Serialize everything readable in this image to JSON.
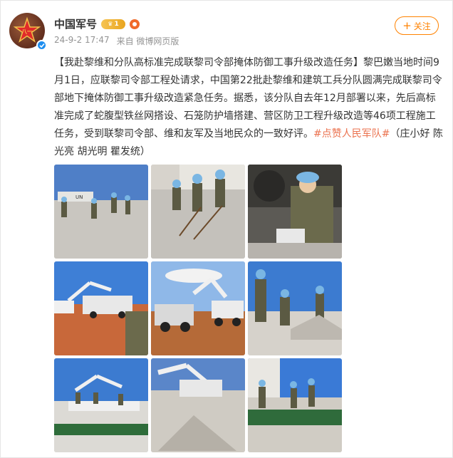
{
  "post": {
    "author": "中国军号",
    "vip_level": "1",
    "timestamp": "24-9-2 17:47",
    "source": "来自 微博网页版",
    "follow_label": "关注",
    "text_main": "【我赴黎维和分队高标准完成联黎司令部掩体防御工事升级改造任务】黎巴嫩当地时间9月1日，应联黎司令部工程处请求，中国第22批赴黎维和建筑工兵分队圆满完成联黎司令部地下掩体防御工事升级改造紧急任务。据悉，该分队自去年12月部署以来，先后高标准完成了蛇腹型铁丝网搭设、石笼防护墙搭建、营区防卫工程升级改造等46项工程施工任务，受到联黎司令部、维和友军及当地民众的一致好评。",
    "hashtag": "#点赞人民军队#",
    "credits": "（庄小好 陈光亮 胡光明 瞿发统）"
  },
  "colors": {
    "accent_orange": "#ff8200",
    "tag_color": "#eb7350",
    "meta_gray": "#939393"
  },
  "images": [
    {
      "name": "photo-1",
      "scene": "soldiers shoveling gravel"
    },
    {
      "name": "photo-2",
      "scene": "soldiers shoveling gravel"
    },
    {
      "name": "photo-3",
      "scene": "soldier pouring cement bag"
    },
    {
      "name": "photo-4",
      "scene": "excavator and truck"
    },
    {
      "name": "photo-5",
      "scene": "excavator loading truck"
    },
    {
      "name": "photo-6",
      "scene": "soldiers shoveling"
    },
    {
      "name": "photo-7",
      "scene": "soldiers on bunker wall"
    },
    {
      "name": "photo-8",
      "scene": "excavator on gravel"
    },
    {
      "name": "photo-9",
      "scene": "soldiers on gabion wall"
    }
  ]
}
